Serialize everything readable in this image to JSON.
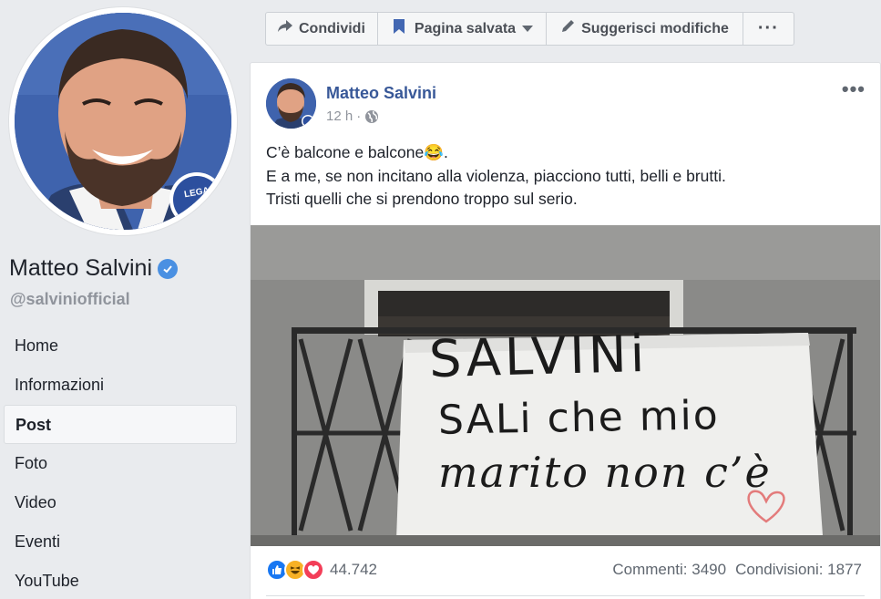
{
  "sidebar": {
    "page_name": "Matteo Salvini",
    "handle": "@salviniofficial",
    "nav": [
      {
        "label": "Home"
      },
      {
        "label": "Informazioni"
      },
      {
        "label": "Post"
      },
      {
        "label": "Foto"
      },
      {
        "label": "Video"
      },
      {
        "label": "Eventi"
      },
      {
        "label": "YouTube"
      }
    ],
    "active_item": "Post",
    "badge_text": "LEGA"
  },
  "actions": {
    "share_label": "Condividi",
    "saved_label": "Pagina salvata",
    "suggest_label": "Suggerisci modifiche",
    "more_label": "···"
  },
  "post": {
    "author": "Matteo Salvini",
    "time": "12 h",
    "separator": "·",
    "text_lines": [
      "C’è balcone e balcone😂.",
      "E a me, se non incitano alla violenza, piacciono tutti, belli e brutti.",
      "Tristi quelli che si prendono troppo sul serio."
    ],
    "banner_lines": [
      "SALVINi",
      "SALi che mio",
      "marito non c’è"
    ],
    "menu": "•••",
    "reaction_count": "44.742",
    "comments": "Commenti: 3490",
    "shares": "Condivisioni: 1877"
  },
  "colors": {
    "link_blue": "#385898",
    "verified_blue": "#4a90e2",
    "like_blue": "#1877f2",
    "love_red": "#f33e58",
    "haha_yellow": "#f7b125"
  },
  "icons": [
    "share-icon",
    "bookmark-icon",
    "caret-down-icon",
    "pencil-icon",
    "more-icon",
    "globe-icon",
    "verified-icon",
    "like-icon",
    "haha-icon",
    "love-icon"
  ]
}
